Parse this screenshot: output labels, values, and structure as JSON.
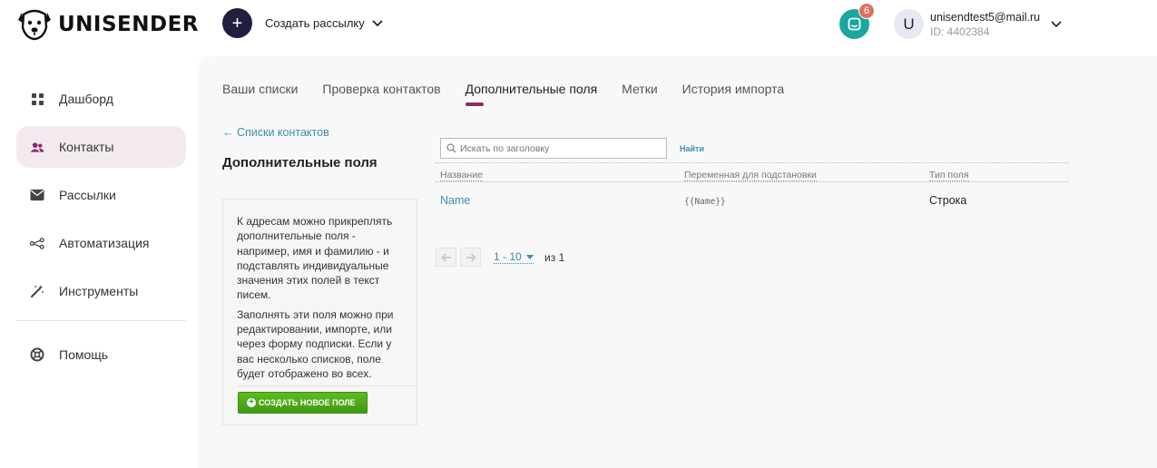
{
  "brand": {
    "name": "UNISENDER"
  },
  "header": {
    "create_label": "Создать рассылку",
    "notifications_count": "6",
    "avatar_letter": "U",
    "user_email": "unisendtest5@mail.ru",
    "user_id": "ID: 4402384"
  },
  "sidebar": {
    "items": [
      {
        "label": "Дашборд",
        "icon": "dashboard-icon"
      },
      {
        "label": "Контакты",
        "icon": "contacts-icon",
        "active": true
      },
      {
        "label": "Рассылки",
        "icon": "mail-icon"
      },
      {
        "label": "Автоматизация",
        "icon": "automation-icon"
      },
      {
        "label": "Инструменты",
        "icon": "magic-wand-icon"
      },
      {
        "label": "Помощь",
        "icon": "help-lifebuoy-icon"
      }
    ]
  },
  "tabs": [
    {
      "label": "Ваши списки"
    },
    {
      "label": "Проверка контактов"
    },
    {
      "label": "Дополнительные поля",
      "active": true
    },
    {
      "label": "Метки"
    },
    {
      "label": "История импорта"
    }
  ],
  "content": {
    "back_link": "← Списки контактов",
    "title": "Дополнительные поля",
    "info_paragraph_1": "К адресам можно прикреплять дополнительные поля - например, имя и фамилию - и подставлять индивидуальные значения этих полей в текст писем.",
    "info_paragraph_2": "Заполнять эти поля можно при редактировании, импорте, или через форму подписки. Если у вас несколько списков, поле будет отображено во всех.",
    "create_field_label": "СОЗДАТЬ НОВОЕ ПОЛЕ",
    "search_placeholder": "Искать по заголовку",
    "find_label": "Найти"
  },
  "table": {
    "columns": [
      "Название",
      "Переменная для подстановки",
      "Тип поля"
    ],
    "rows": [
      {
        "name": "Name",
        "variable": "{{Name}}",
        "type": "Строка"
      }
    ]
  },
  "pager": {
    "range": "1 - 10",
    "of": "из 1"
  },
  "colors": {
    "accent": "#8b2a6b",
    "link": "#3c8fa8",
    "notification": "#19a7a0",
    "badge": "#d9745c",
    "button_green": "#4aa817"
  }
}
